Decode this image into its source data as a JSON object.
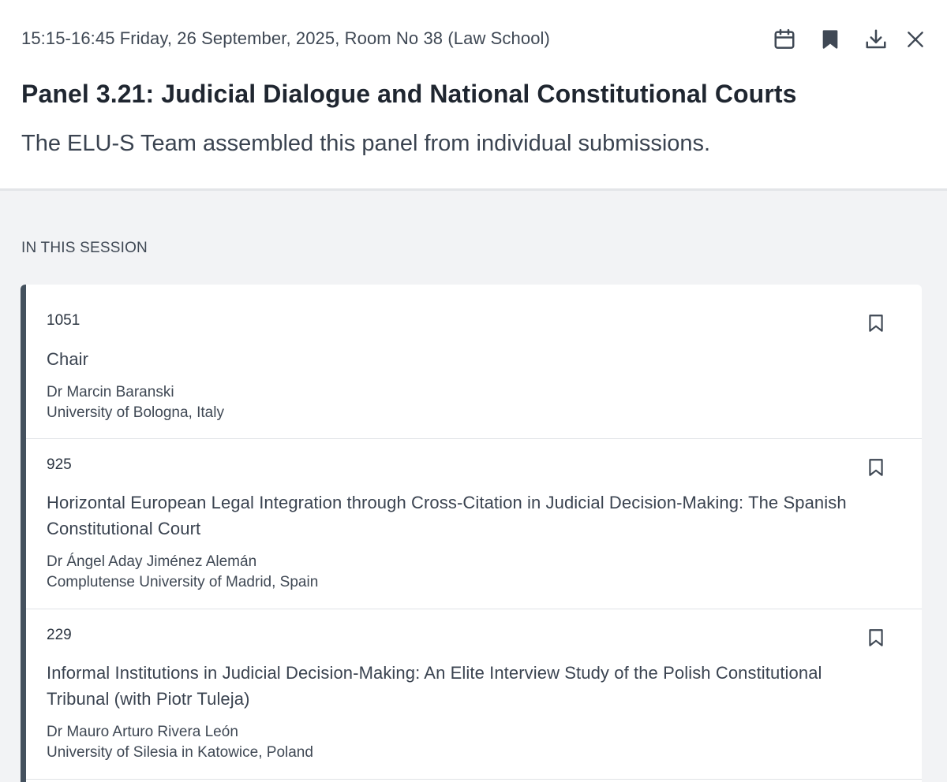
{
  "session": {
    "meta": "15:15-16:45 Friday, 26 September, 2025, Room No 38 (Law School)",
    "title": "Panel 3.21: Judicial Dialogue and National Constitutional Courts",
    "description": "The ELU-S Team assembled this panel from individual submissions."
  },
  "actions": {
    "icons": [
      "calendar-icon",
      "bookmark-filled-icon",
      "download-icon",
      "close-icon"
    ]
  },
  "section_label": "IN THIS SESSION",
  "items": [
    {
      "id": "1051",
      "title": "Chair",
      "author": "Dr Marcin Baranski",
      "affiliation": "University of Bologna, Italy"
    },
    {
      "id": "925",
      "title": "Horizontal European Legal Integration through Cross-Citation in Judicial Decision-Making: The Spanish Constitutional Court",
      "author": "Dr Ángel Aday Jiménez Alemán",
      "affiliation": "Complutense University of Madrid, Spain"
    },
    {
      "id": "229",
      "title": "Informal Institutions in Judicial Decision-Making: An Elite Interview Study of the Polish Constitutional Tribunal (with Piotr Tuleja)",
      "author": "Dr Mauro Arturo Rivera León",
      "affiliation": "University of Silesia in Katowice, Poland"
    }
  ],
  "colors": {
    "accent_bar": "#44515e",
    "icon": "#3f4854",
    "background": "#f2f3f5"
  }
}
